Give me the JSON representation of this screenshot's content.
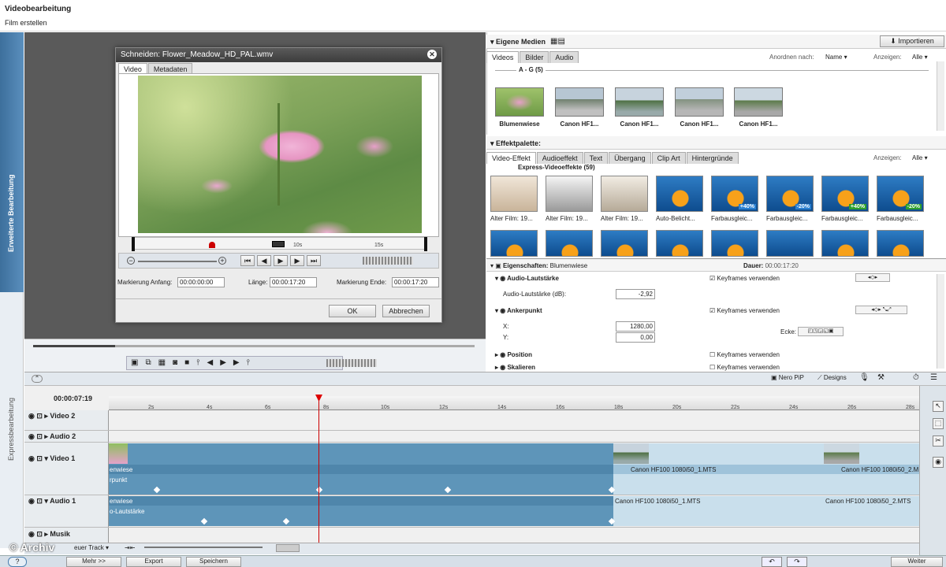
{
  "app": {
    "title": "Videobearbeitung",
    "subtitle": "Film erstellen"
  },
  "side_tabs": {
    "advanced": "Erweiterte Bearbeitung",
    "express": "Expressbearbeitung"
  },
  "dialog": {
    "title": "Schneiden: Flower_Meadow_HD_PAL.wmv",
    "tabs": [
      "Video",
      "Metadaten"
    ],
    "ticks": [
      "10s",
      "15s"
    ],
    "mark_start_label": "Markierung Anfang:",
    "mark_start_value": "00:00:00:00",
    "length_label": "Länge:",
    "length_value": "00:00:17:20",
    "mark_end_label": "Markierung Ende:",
    "mark_end_value": "00:00:17:20",
    "ok": "OK",
    "cancel": "Abbrechen"
  },
  "media": {
    "title": "Eigene Medien",
    "import": "Importieren",
    "tabs": [
      "Videos",
      "Bilder",
      "Audio"
    ],
    "sort_label": "Anordnen nach:",
    "sort_value": "Name",
    "show_label": "Anzeigen:",
    "show_value": "Alle",
    "group": "A - G (5)",
    "items": [
      "Blumenwiese",
      "Canon HF1...",
      "Canon HF1...",
      "Canon HF1...",
      "Canon HF1..."
    ]
  },
  "effects": {
    "title": "Effektpalette:",
    "tabs": [
      "Video-Effekt",
      "Audioeffekt",
      "Text",
      "Übergang",
      "Clip Art",
      "Hintergründe"
    ],
    "show_label": "Anzeigen:",
    "show_value": "Alle",
    "group": "Express-Videoeffekte (59)",
    "items": [
      "Alter Film: 19...",
      "Alter Film: 19...",
      "Alter Film: 19...",
      "Auto-Belicht...",
      "Farbausgleic...",
      "Farbausgleic...",
      "Farbausgleic...",
      "Farbausgleic..."
    ],
    "badges": [
      "+40%",
      "-20%",
      "+40%",
      "-20%"
    ]
  },
  "properties": {
    "title": "Eigenschaften:",
    "clip": "Blumenwiese",
    "duration_label": "Dauer:",
    "duration_value": "00:00:17:20",
    "keyframes": "Keyframes verwenden",
    "audio_section": "Audio-Lautstärke",
    "audio_label": "Audio-Lautstärke (dB):",
    "audio_value": "-2,92",
    "anchor_section": "Ankerpunkt",
    "x_label": "X:",
    "x_value": "1280,00",
    "y_label": "Y:",
    "y_value": "0,00",
    "corner_label": "Ecke:",
    "position_section": "Position",
    "scale_section": "Skalieren"
  },
  "timeline": {
    "timecode": "00:00:07:19",
    "nero_pip": "Nero PiP",
    "designs": "Designs",
    "ruler": [
      "2s",
      "4s",
      "6s",
      "8s",
      "10s",
      "12s",
      "14s",
      "16s",
      "18s",
      "20s",
      "22s",
      "24s",
      "26s",
      "28s"
    ],
    "tracks": [
      "Video 2",
      "Audio 2",
      "Video 1",
      "Audio 1",
      "Musik"
    ],
    "clips": {
      "v1a": "enwiese",
      "v1a_sub": "rpunkt",
      "v1b": "Canon HF100 1080i50_1.MTS",
      "v1c": "Canon HF100 1080i50_2.M",
      "a1a": "enwiese",
      "a1a_sub": "o-Lautstärke",
      "a1b": "Canon HF100 1080i50_1.MTS",
      "a1c": "Canon HF100 1080i50_2.MTS"
    },
    "new_track": "euer Track",
    "watermark": "© Archiv"
  },
  "bottom": {
    "more": "Mehr >>",
    "export": "Export",
    "save": "Speichern",
    "next": "Weiter"
  }
}
